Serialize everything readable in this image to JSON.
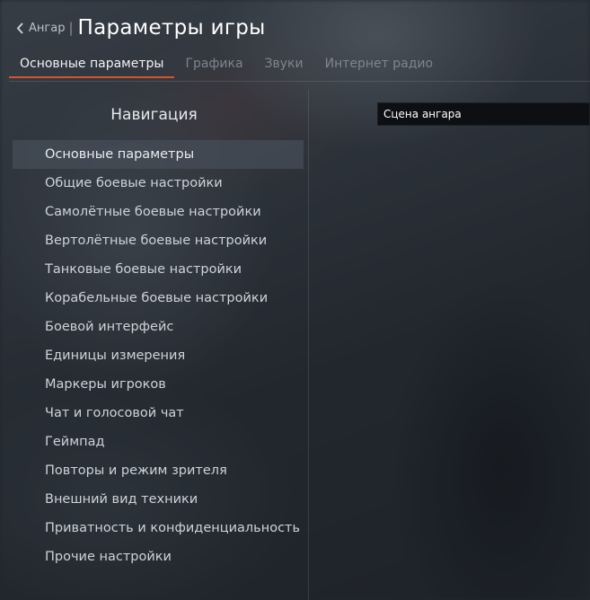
{
  "header": {
    "back_label": "Ангар",
    "separator": "|",
    "title": "Параметры игры"
  },
  "tabs": [
    {
      "label": "Основные параметры",
      "active": true
    },
    {
      "label": "Графика",
      "active": false
    },
    {
      "label": "Звуки",
      "active": false
    },
    {
      "label": "Интернет радио",
      "active": false
    }
  ],
  "navigation": {
    "heading": "Навигация",
    "items": [
      {
        "label": "Основные параметры",
        "selected": true
      },
      {
        "label": "Общие боевые настройки"
      },
      {
        "label": "Самолётные боевые настройки"
      },
      {
        "label": "Вертолётные боевые настройки"
      },
      {
        "label": "Танковые боевые настройки"
      },
      {
        "label": "Корабельные боевые настройки"
      },
      {
        "label": "Боевой интерфейс"
      },
      {
        "label": "Единицы измерения"
      },
      {
        "label": "Маркеры игроков"
      },
      {
        "label": "Чат и голосовой чат"
      },
      {
        "label": "Геймпад"
      },
      {
        "label": "Повторы и режим зрителя"
      },
      {
        "label": "Внешний вид техники"
      },
      {
        "label": "Приватность и конфиденциальность"
      },
      {
        "label": "Прочие настройки"
      }
    ]
  },
  "search": {
    "value": "Сцена ангара"
  },
  "colors": {
    "accent": "#d4552b"
  }
}
